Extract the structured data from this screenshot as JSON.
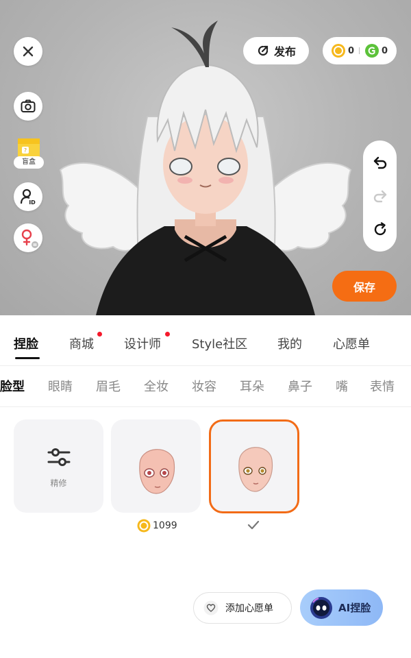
{
  "top_bar": {
    "publish_label": "发布",
    "gold_coins": "0",
    "green_coins": "0"
  },
  "side_tools": {
    "blindbox_label": "盲盒"
  },
  "save_label": "保存",
  "main_tabs": [
    {
      "label": "捏脸",
      "active": true,
      "dot": false
    },
    {
      "label": "商城",
      "active": false,
      "dot": true
    },
    {
      "label": "设计师",
      "active": false,
      "dot": true
    },
    {
      "label": "Style社区",
      "active": false,
      "dot": false
    },
    {
      "label": "我的",
      "active": false,
      "dot": false
    },
    {
      "label": "心愿单",
      "active": false,
      "dot": false
    }
  ],
  "sub_tabs": [
    {
      "label": "脸型",
      "active": true
    },
    {
      "label": "眼睛",
      "active": false
    },
    {
      "label": "眉毛",
      "active": false
    },
    {
      "label": "全妆",
      "active": false
    },
    {
      "label": "妆容",
      "active": false
    },
    {
      "label": "耳朵",
      "active": false
    },
    {
      "label": "鼻子",
      "active": false
    },
    {
      "label": "嘴",
      "active": false
    },
    {
      "label": "表情",
      "active": false
    }
  ],
  "items": {
    "refine_label": "精修",
    "price": "1099"
  },
  "actions": {
    "wishlist_label": "添加心愿单",
    "ai_label": "AI捏脸"
  },
  "colors": {
    "accent": "#f56d13",
    "selected_border": "#f26b16",
    "notification_dot": "#f5192b",
    "coin_gold": "#f6b81c",
    "coin_green": "#5cc23a"
  },
  "icons": {
    "close": "close-icon",
    "camera": "camera-icon",
    "id": "user-id-icon",
    "gender": "female-swap-icon",
    "undo": "undo-icon",
    "redo": "redo-icon",
    "reset": "reset-icon",
    "refine": "sliders-icon",
    "check": "check-icon",
    "heart": "heart-icon"
  }
}
